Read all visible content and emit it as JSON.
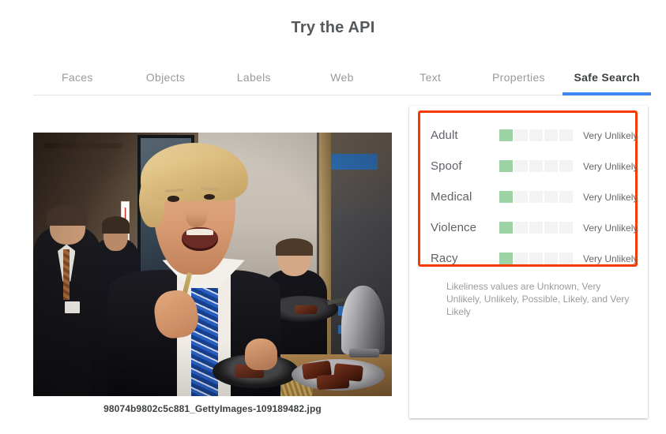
{
  "header": {
    "title": "Try the API"
  },
  "tabs": [
    {
      "label": "Faces",
      "active": false
    },
    {
      "label": "Objects",
      "active": false
    },
    {
      "label": "Labels",
      "active": false
    },
    {
      "label": "Web",
      "active": false
    },
    {
      "label": "Text",
      "active": false
    },
    {
      "label": "Properties",
      "active": false
    },
    {
      "label": "Safe Search",
      "active": true
    }
  ],
  "image": {
    "filename": "98074b9802c5c881_GettyImages-109189482.jpg",
    "alt": "Man in dark suit and blue striped tie eating a piece of steak from a fork at a catered event"
  },
  "safe_search": {
    "highlight_color": "#f63b00",
    "filled_color": "#9ed3a5",
    "empty_color": "#f3f3f3",
    "segments_total": 5,
    "rows": [
      {
        "label": "Adult",
        "value": "Very Unlikely",
        "filled": 1
      },
      {
        "label": "Spoof",
        "value": "Very Unlikely",
        "filled": 1
      },
      {
        "label": "Medical",
        "value": "Very Unlikely",
        "filled": 1
      },
      {
        "label": "Violence",
        "value": "Very Unlikely",
        "filled": 1
      },
      {
        "label": "Racy",
        "value": "Very Unlikely",
        "filled": 1
      }
    ],
    "legend": "Likeliness values are Unknown, Very Unlikely, Unlikely, Possible, Likely, and Very Likely"
  },
  "theme": {
    "accent_blue": "#4285f4",
    "text_dark": "#3c4043",
    "text_muted": "#9a9a9a"
  }
}
